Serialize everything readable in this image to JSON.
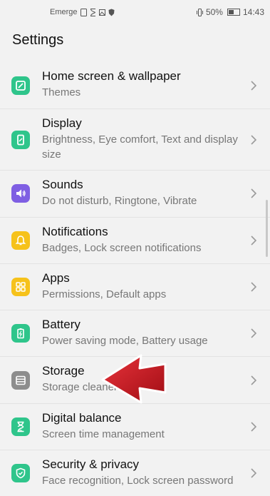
{
  "status_bar": {
    "carrier": "Emerge",
    "battery_percent": "50%",
    "time": "14:43",
    "battery_level": 0.5
  },
  "header": {
    "title": "Settings"
  },
  "settings": [
    {
      "title": "Home screen & wallpaper",
      "subtitle": "Themes",
      "icon": "home-screen-icon",
      "color": "#2fc58b"
    },
    {
      "title": "Display",
      "subtitle": "Brightness, Eye comfort, Text and display size",
      "icon": "display-icon",
      "color": "#2fc58b"
    },
    {
      "title": "Sounds",
      "subtitle": "Do not disturb, Ringtone, Vibrate",
      "icon": "sound-icon",
      "color": "#7f5fe3"
    },
    {
      "title": "Notifications",
      "subtitle": "Badges, Lock screen notifications",
      "icon": "bell-icon",
      "color": "#f6c21b"
    },
    {
      "title": "Apps",
      "subtitle": "Permissions, Default apps",
      "icon": "apps-icon",
      "color": "#f6c21b"
    },
    {
      "title": "Battery",
      "subtitle": "Power saving mode, Battery usage",
      "icon": "battery-icon",
      "color": "#2fc58b"
    },
    {
      "title": "Storage",
      "subtitle": "Storage cleaner",
      "icon": "storage-icon",
      "color": "#8d8d8d"
    },
    {
      "title": "Digital balance",
      "subtitle": "Screen time management",
      "icon": "hourglass-icon",
      "color": "#2fc58b"
    },
    {
      "title": "Security & privacy",
      "subtitle": "Face recognition, Lock screen password",
      "icon": "shield-icon",
      "color": "#2fc58b"
    }
  ],
  "annotation": {
    "arrow_color": "#d0121b",
    "target": "Storage"
  }
}
